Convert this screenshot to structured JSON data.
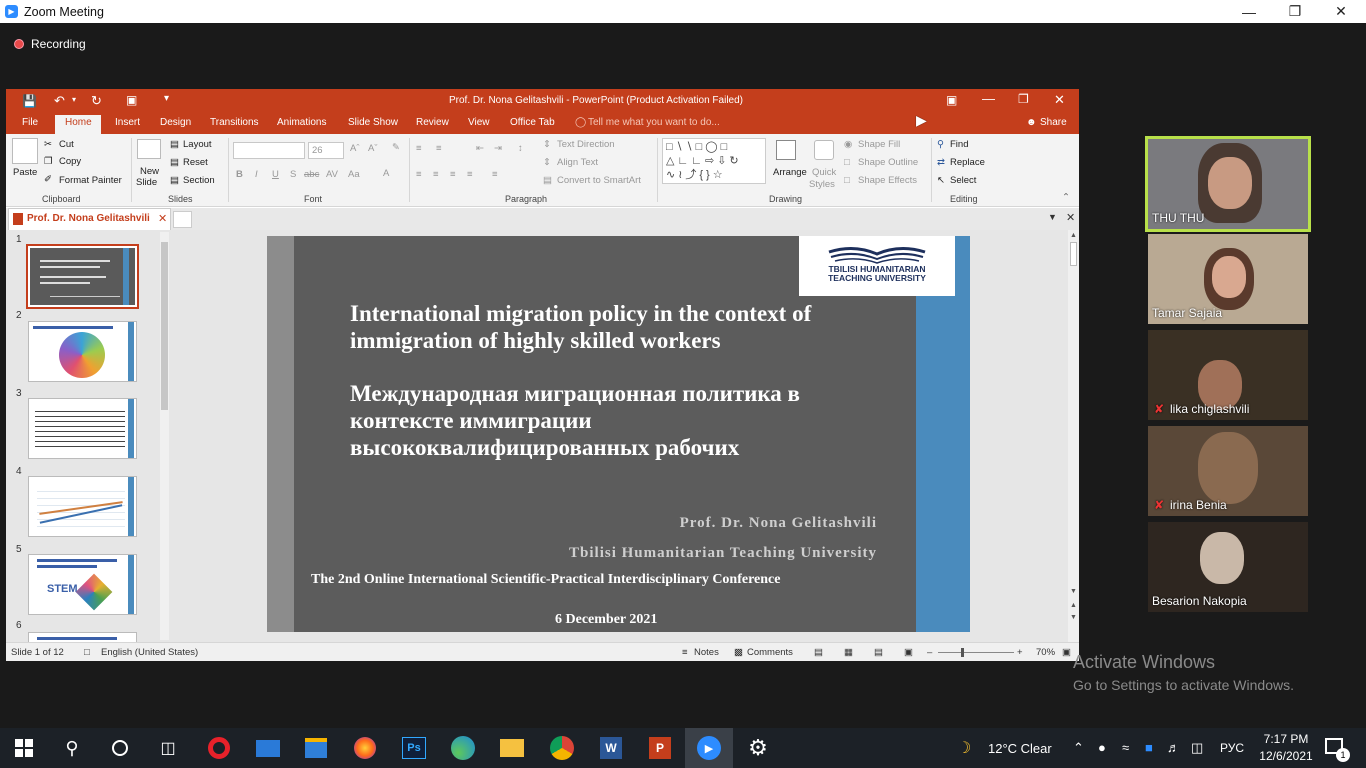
{
  "zoom": {
    "window_title": "Zoom Meeting",
    "recording_label": "Recording",
    "participants": [
      {
        "name": "THU THU",
        "muted": false,
        "active_speaker": true
      },
      {
        "name": "Tamar Sajaia",
        "muted": false
      },
      {
        "name": "lika chiglashvili",
        "muted": true
      },
      {
        "name": "irina Benia",
        "muted": true
      },
      {
        "name": "Besarion Nakopia",
        "muted": false
      }
    ]
  },
  "ppt": {
    "window_title": "Prof. Dr. Nona Gelitashvili  -  PowerPoint (Product Activation Failed)",
    "tabs": [
      "File",
      "Home",
      "Insert",
      "Design",
      "Transitions",
      "Animations",
      "Slide Show",
      "Review",
      "View",
      "Office Tab"
    ],
    "active_tab": "Home",
    "tell_me": "Tell me what you want to do...",
    "share": "Share",
    "ribbon": {
      "clipboard": {
        "paste": "Paste",
        "cut": "Cut",
        "copy": "Copy",
        "format_painter": "Format Painter",
        "group": "Clipboard"
      },
      "slides": {
        "new_slide_1": "New",
        "new_slide_2": "Slide",
        "layout": "Layout",
        "reset": "Reset",
        "section": "Section",
        "group": "Slides"
      },
      "font": {
        "size": "26",
        "group": "Font"
      },
      "paragraph": {
        "text_direction": "Text Direction",
        "align_text": "Align Text",
        "convert_smartart": "Convert to SmartArt",
        "group": "Paragraph"
      },
      "drawing": {
        "arrange": "Arrange",
        "quick_styles_1": "Quick",
        "quick_styles_2": "Styles",
        "shape_fill": "Shape Fill",
        "shape_outline": "Shape Outline",
        "shape_effects": "Shape Effects",
        "group": "Drawing"
      },
      "editing": {
        "find": "Find",
        "replace": "Replace",
        "select": "Select",
        "group": "Editing"
      }
    },
    "doc_tab": "Prof. Dr. Nona Gelitashvili",
    "thumbnails": [
      "1",
      "2",
      "3",
      "4",
      "5",
      "6"
    ],
    "thumb_texts": {
      "t5_title": "STEM"
    },
    "slide": {
      "logo_line1": "TBILISI HUMANITARIAN",
      "logo_line2": "TEACHING UNIVERSITY",
      "title_en_1": "International migration policy in the context of",
      "title_en_2": "immigration of highly skilled workers",
      "title_ru_1": "Международная миграционная политика в",
      "title_ru_2": "контексте иммиграции",
      "title_ru_3": "высококвалифицированных рабочих",
      "author": "Prof. Dr. Nona Gelitashvili",
      "university": "Tbilisi Humanitarian Teaching University",
      "conference": "The 2nd Online International Scientific-Practical Interdisciplinary Conference",
      "date": "6 December 2021"
    },
    "status": {
      "slide_of": "Slide 1 of 12",
      "language": "English (United States)",
      "notes": "Notes",
      "comments": "Comments",
      "zoom": "70%"
    }
  },
  "watermark": {
    "line1": "Activate Windows",
    "line2": "Go to Settings to activate Windows."
  },
  "taskbar": {
    "weather": "12°C  Clear",
    "lang": "РУС",
    "time": "7:17 PM",
    "date": "12/6/2021",
    "notifications": "1"
  }
}
